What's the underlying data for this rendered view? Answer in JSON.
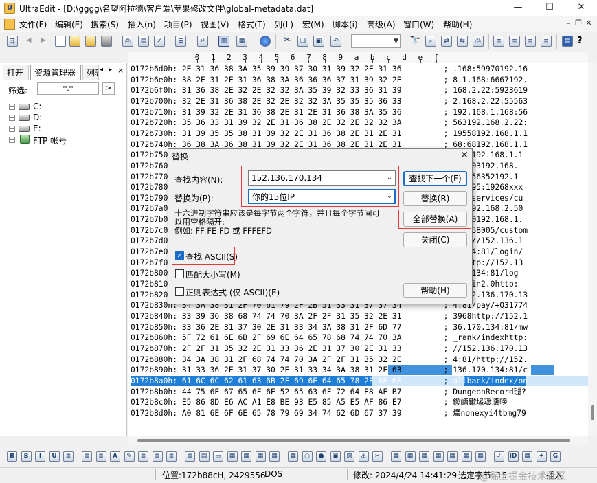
{
  "window": {
    "title": "UltraEdit - [D:\\gggg\\名望阿拉德\\客户端\\苹果修改文件\\global-metadata.dat]",
    "app_icon_letter": "U",
    "minimize_glyph": "—",
    "maximize_glyph": "☐",
    "close_glyph": "✕"
  },
  "menu": {
    "items": [
      "文件(F)",
      "编辑(E)",
      "搜索(S)",
      "插入(n)",
      "项目(P)",
      "视图(V)",
      "格式(T)",
      "列(L)",
      "宏(M)",
      "脚本(i)",
      "高级(A)",
      "窗口(W)",
      "帮助(H)"
    ],
    "mdi_controls": [
      "–",
      "❐",
      "✕"
    ]
  },
  "toolbar": {
    "icons": [
      "save-all",
      "back",
      "forward",
      "new-file",
      "open-file",
      "open-folder",
      "save",
      "print",
      "print-preview",
      "spell-check",
      "file-info",
      "hex-mode",
      "word-wrap",
      "browser",
      "cut",
      "copy",
      "paste",
      "find",
      "find-in-files",
      "replace",
      "replace-in-files",
      "printer",
      "align-left",
      "align-center",
      "align-right",
      "justify",
      "function-list",
      "help"
    ],
    "combo_value": ""
  },
  "left_panel": {
    "tabs": [
      "打开",
      "资源管理器",
      "列表"
    ],
    "tab_nav": [
      "◂",
      "▸",
      "×"
    ],
    "filter_label": "筛选:",
    "filter_value": "*.*",
    "filter_button": ">",
    "tree": [
      {
        "label": "C:",
        "icon": "drive-icon"
      },
      {
        "label": "D:",
        "icon": "drive-icon"
      },
      {
        "label": "E:",
        "icon": "drive-icon"
      },
      {
        "label": "FTP 帐号",
        "icon": "network-icon"
      }
    ]
  },
  "hex_view": {
    "ruler": [
      "0",
      "1",
      "2",
      "3",
      "4",
      "5",
      "6",
      "7",
      "8",
      "9",
      "a",
      "b",
      "c",
      "d",
      "e",
      "f"
    ],
    "rows": [
      {
        "addr": "0172b6d0h:",
        "hex": "2E 31 36 38 3A 35 39 39 37 30 31 39 32 2E 31 36",
        "text": ".168:59970192.16"
      },
      {
        "addr": "0172b6e0h:",
        "hex": "38 2E 31 2E 31 36 38 3A 36 36 36 37 31 39 32 2E",
        "text": "8.1.168:6667192."
      },
      {
        "addr": "0172b6f0h:",
        "hex": "31 36 38 2E 32 2E 32 32 3A 35 39 32 33 36 31 39",
        "text": "168.2.22:5923619"
      },
      {
        "addr": "0172b700h:",
        "hex": "32 2E 31 36 38 2E 32 2E 32 32 3A 35 35 35 36 33",
        "text": "2.168.2.22:55563"
      },
      {
        "addr": "0172b710h:",
        "hex": "31 39 32 2E 31 36 38 2E 31 2E 31 36 38 3A 35 36",
        "text": "192.168.1.168:56"
      },
      {
        "addr": "0172b720h:",
        "hex": "35 36 33 31 39 32 2E 31 36 38 2E 32 2E 32 32 3A",
        "text": "563192.168.2.22:"
      },
      {
        "addr": "0172b730h:",
        "hex": "31 39 35 35 38 31 39 32 2E 31 36 38 2E 31 2E 31",
        "text": "19558192.168.1.1"
      },
      {
        "addr": "0172b740h:",
        "hex": "36 38 3A 36 38 31 39 32 2E 31 36 38 2E 31 2E 31",
        "text": "68:68192.168.1.1"
      },
      {
        "addr": "0172b750h:",
        "hex": "",
        "text": "3002192.168.1.1"
      },
      {
        "addr": "0172b760h:",
        "hex": "",
        "text": ":58003192.168."
      },
      {
        "addr": "0172b770h:",
        "hex": "",
        "text": "168:56352192.1"
      },
      {
        "addr": "0172b780h:",
        "hex": "",
        "text": "2.2.95:19268xxx"
      },
      {
        "addr": "0172b790h:",
        "hex": "",
        "text": "com/services/cu"
      },
      {
        "addr": "0172b7a0h:",
        "hex": "",
        "text": "com192.168.2.50"
      },
      {
        "addr": "0172b7b0h:",
        "hex": "",
        "text": "58300192.168.1."
      },
      {
        "addr": "0172b7c0h:",
        "hex": "",
        "text": "158:58005/custom"
      },
      {
        "addr": "0172b7d0h:",
        "hex": "",
        "text": "ttp://152.136.1"
      },
      {
        "addr": "0172b7e0h:",
        "hex": "",
        "text": "0.134:81/login/"
      },
      {
        "addr": "0172b7f0h:",
        "hex": "",
        "text": "eghttp://152.13"
      },
      {
        "addr": "0172b800h:",
        "hex": "",
        "text": "170.134:81/log"
      },
      {
        "addr": "0172b810h:",
        "hex": "",
        "text": "/login2.0http:"
      },
      {
        "addr": "0172b820h:",
        "hex": "",
        "text": "//152.136.170.13"
      },
      {
        "addr": "0172b830h:",
        "hex": "34 3A 38 31 2F 70 61 79 2F 2B 51 33 31 37 37 34",
        "text": "4:81/pay/+Q31774"
      },
      {
        "addr": "0172b840h:",
        "hex": "33 39 36 38 68 74 74 70 3A 2F 2F 31 35 32 2E 31",
        "text": "3968http://152.1"
      },
      {
        "addr": "0172b850h:",
        "hex": "33 36 2E 31 37 30 2E 31 33 34 3A 38 31 2F 6D 77",
        "text": "36.170.134:81/mw"
      },
      {
        "addr": "0172b860h:",
        "hex": "5F 72 61 6E 6B 2F 69 6E 64 65 78 68 74 74 70 3A",
        "text": "_rank/indexhttp:"
      },
      {
        "addr": "0172b870h:",
        "hex": "2F 2F 31 35 32 2E 31 33 36 2E 31 37 30 2E 31 33",
        "text": "//152.136.170.13"
      },
      {
        "addr": "0172b880h:",
        "hex": "34 3A 38 31 2F 68 74 74 70 3A 2F 2F 31 35 32 2E",
        "text": "4:81/http://152."
      },
      {
        "addr": "0172b890h:",
        "hex": "31 33 36 2E 31 37 30 2E 31 33 34 3A 38 31 2F 63",
        "text": "136.170.134:81/c"
      },
      {
        "addr": "0172b8a0h:",
        "hex": "61 6C 6C 62 61 63 6B 2F 69 6E 64 65 78 2F 6F 6E",
        "text": "allback/index/on"
      },
      {
        "addr": "0172b8b0h:",
        "hex": "44 75 6E 67 65 6F 6E 52 65 63 6F 72 64 E8 AF B7",
        "text": "DungeonRecord琎?"
      },
      {
        "addr": "0172b8c0h:",
        "hex": "E5 86 8D E6 AC A1 E8 BE 93 E5 85 A5 E5 AF 86 E7",
        "text": "鍐嶆鏉堟叆瀵嗙"
      },
      {
        "addr": "0172b8d0h:",
        "hex": "A0 81 6E 6F 6E 65 78 79 69 34 74 62 6D 67 37 39",
        "text": "爜nonexyi4tbmg79"
      }
    ]
  },
  "dialog": {
    "title": "替换",
    "find_label": "查找内容(N):",
    "find_value": "152.136.170.134",
    "replace_label": "替换为(P):",
    "replace_value": "你的15位IP",
    "note_line1": "十六进制字符串应该是每字节两个字符，并且每个字节间可",
    "note_line2": "以用空格隔开:",
    "note_line3": "例如: FF FE FD 或 FFFEFD",
    "opt_ascii": "查找 ASCII(S)",
    "opt_case": "匹配大小写(M)",
    "opt_regex": "正则表达式 (仅 ASCII)(E)",
    "btn_find_next": "查找下一个(F)",
    "btn_replace": "替换(R)",
    "btn_replace_all": "全部替换(A)",
    "btn_close": "关闭(C)",
    "btn_help": "帮助(H)",
    "close_glyph": "✕"
  },
  "bottom_toolbar": {
    "icons": [
      "B",
      "B",
      "I",
      "U",
      "≡",
      "≡",
      "≡",
      "A",
      "✎",
      "≡",
      "≡",
      "≡",
      "≡",
      "▤",
      "▭",
      "▦",
      "▦",
      "▦",
      "▦",
      "▦",
      "○",
      "●",
      "▣",
      "▨",
      "⚓",
      "✂",
      "▦",
      "▦",
      "▦",
      "▦",
      "▦",
      "▦",
      "▦",
      "✓",
      "ID",
      "▦",
      "✦",
      "G"
    ]
  },
  "status": {
    "position": "位置:172b88cH, 2429556",
    "format": "DOS",
    "modified": "修改:   2024/4/24 14:41:29",
    "selected": "选定字节: 15",
    "mode": "插入"
  },
  "watermark": "@稀土掘金技术社区",
  "colors": {
    "selection": "#1f7fd6",
    "accent": "#1a6ec7",
    "highlight_box": "#e03a3a"
  }
}
